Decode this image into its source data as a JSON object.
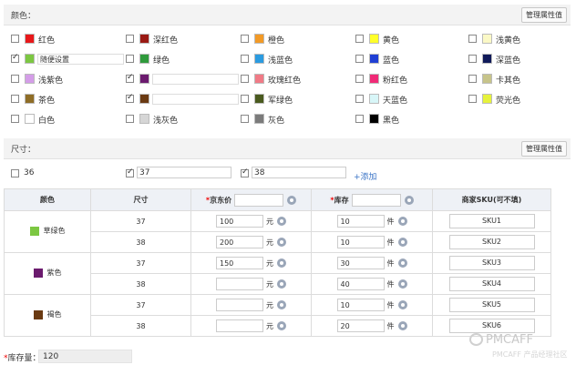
{
  "color_section": {
    "title": "颜色：",
    "manage_label": "管理属性值"
  },
  "colors": [
    {
      "name": "红色",
      "hex": "#e8181a",
      "checked": false
    },
    {
      "name": "深红色",
      "hex": "#9a1a14",
      "checked": false
    },
    {
      "name": "橙色",
      "hex": "#f29a26",
      "checked": false
    },
    {
      "name": "黄色",
      "hex": "#ffff2a",
      "checked": false
    },
    {
      "name": "浅黄色",
      "hex": "#fbf9c6",
      "checked": false
    },
    {
      "name": "",
      "hex": "#7cc742",
      "checked": true,
      "input": "随便设置"
    },
    {
      "name": "绿色",
      "hex": "#2f9a3c",
      "checked": false
    },
    {
      "name": "浅蓝色",
      "hex": "#2b9be0",
      "checked": false
    },
    {
      "name": "蓝色",
      "hex": "#1f3fd4",
      "checked": false
    },
    {
      "name": "深蓝色",
      "hex": "#101a5a",
      "checked": false
    },
    {
      "name": "浅紫色",
      "hex": "#d49de8",
      "checked": false
    },
    {
      "name": "紫色",
      "hex": "#6b1b6e",
      "checked": true,
      "input": ""
    },
    {
      "name": "玫瑰红色",
      "hex": "#f07a86",
      "checked": false
    },
    {
      "name": "粉红色",
      "hex": "#f02a77",
      "checked": false
    },
    {
      "name": "卡其色",
      "hex": "#c7c48a",
      "checked": false
    },
    {
      "name": "茶色",
      "hex": "#8f6d26",
      "checked": false
    },
    {
      "name": "褐色",
      "hex": "#6a3a12",
      "checked": true,
      "input": ""
    },
    {
      "name": "军绿色",
      "hex": "#4a5a1e",
      "checked": false
    },
    {
      "name": "天蓝色",
      "hex": "#d8f6f8",
      "checked": false
    },
    {
      "name": "荧光色",
      "hex": "#e6f23c",
      "checked": false
    },
    {
      "name": "白色",
      "hex": "#ffffff",
      "checked": false
    },
    {
      "name": "浅灰色",
      "hex": "#d6d6d6",
      "checked": false
    },
    {
      "name": "灰色",
      "hex": "#7b7b7b",
      "checked": false
    },
    {
      "name": "黑色",
      "hex": "#000000",
      "checked": false
    }
  ],
  "size_section": {
    "title": "尺寸：",
    "manage_label": "管理属性值",
    "add_label": "+添加"
  },
  "sizes": [
    {
      "value": "36",
      "checked": false,
      "editable": false
    },
    {
      "value": "37",
      "checked": true,
      "editable": true
    },
    {
      "value": "38",
      "checked": true,
      "editable": true
    }
  ],
  "table": {
    "headers": {
      "color": "颜色",
      "size": "尺寸",
      "price": "京东价",
      "stock": "库存",
      "sku": "商家SKU(可不填)"
    },
    "price_unit": "元",
    "stock_unit": "件",
    "groups": [
      {
        "color_name": "草绿色",
        "hex": "#7cc742",
        "rows": [
          {
            "size": "37",
            "price": "100",
            "stock": "10",
            "sku": "SKU1"
          },
          {
            "size": "38",
            "price": "200",
            "stock": "10",
            "sku": "SKU2"
          }
        ]
      },
      {
        "color_name": "紫色",
        "hex": "#6b1b6e",
        "rows": [
          {
            "size": "37",
            "price": "150",
            "stock": "30",
            "sku": "SKU3"
          },
          {
            "size": "38",
            "price": "",
            "stock": "40",
            "sku": "SKU4"
          }
        ]
      },
      {
        "color_name": "褐色",
        "hex": "#6a3a12",
        "rows": [
          {
            "size": "37",
            "price": "",
            "stock": "10",
            "sku": "SKU5"
          },
          {
            "size": "38",
            "price": "",
            "stock": "20",
            "sku": "SKU6"
          }
        ]
      }
    ]
  },
  "stock_total": {
    "label": "库存量：",
    "value": "120"
  },
  "watermark": {
    "text": "PMCAFF",
    "subtext": "PMCAFF 产品经理社区"
  }
}
